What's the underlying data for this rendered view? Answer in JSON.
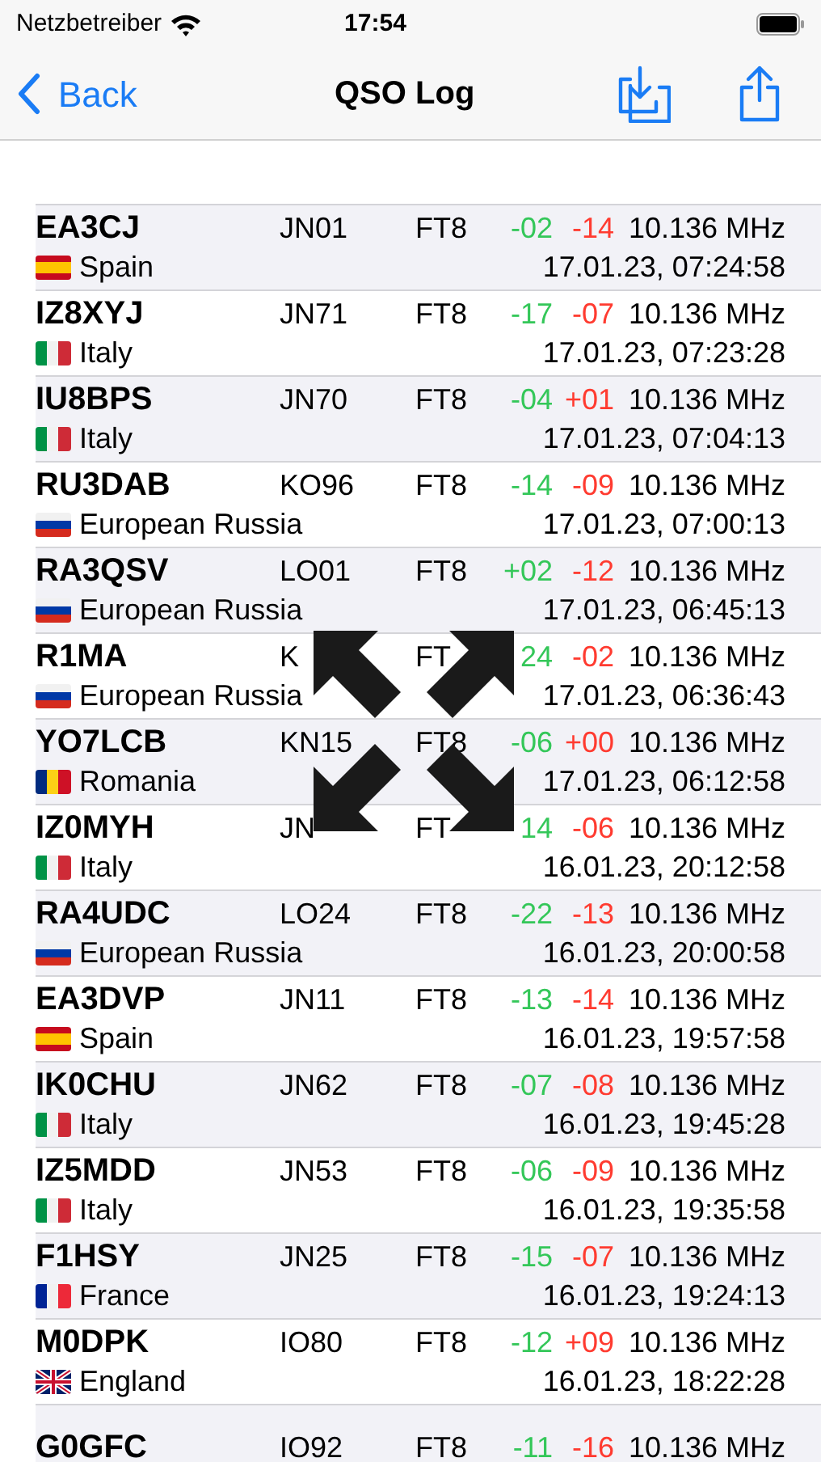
{
  "status_bar": {
    "carrier": "Netzbetreiber",
    "time": "17:54"
  },
  "nav": {
    "back": "Back",
    "title": "QSO Log"
  },
  "rows": [
    {
      "call": "EA3CJ",
      "grid": "JN01",
      "mode": "FT8",
      "sent": "-02",
      "rcvd": "-14",
      "freq": "10.136 MHz",
      "country": {
        "kind": "es",
        "name": "Spain"
      },
      "date": "17.01.23, 07:24:58"
    },
    {
      "call": "IZ8XYJ",
      "grid": "JN71",
      "mode": "FT8",
      "sent": "-17",
      "rcvd": "-07",
      "freq": "10.136 MHz",
      "country": {
        "kind": "it",
        "name": "Italy"
      },
      "date": "17.01.23, 07:23:28"
    },
    {
      "call": "IU8BPS",
      "grid": "JN70",
      "mode": "FT8",
      "sent": "-04",
      "rcvd": "+01",
      "freq": "10.136 MHz",
      "country": {
        "kind": "it",
        "name": "Italy"
      },
      "date": "17.01.23, 07:04:13"
    },
    {
      "call": "RU3DAB",
      "grid": "KO96",
      "mode": "FT8",
      "sent": "-14",
      "rcvd": "-09",
      "freq": "10.136 MHz",
      "country": {
        "kind": "ru",
        "name": "European Russia"
      },
      "date": "17.01.23, 07:00:13"
    },
    {
      "call": "RA3QSV",
      "grid": "LO01",
      "mode": "FT8",
      "sent": "+02",
      "rcvd": "-12",
      "freq": "10.136 MHz",
      "country": {
        "kind": "ru",
        "name": "European Russia"
      },
      "date": "17.01.23, 06:45:13"
    },
    {
      "call": "R1MA",
      "grid": "K",
      "mode": "FT",
      "sent": "24",
      "rcvd": "-02",
      "freq": "10.136 MHz",
      "country": {
        "kind": "ru",
        "name": "European Russia"
      },
      "date": "17.01.23, 06:36:43"
    },
    {
      "call": "YO7LCB",
      "grid": "KN15",
      "mode": "FT8",
      "sent": "-06",
      "rcvd": "+00",
      "freq": "10.136 MHz",
      "country": {
        "kind": "ro",
        "name": "Romania"
      },
      "date": "17.01.23, 06:12:58"
    },
    {
      "call": "IZ0MYH",
      "grid": "JN",
      "mode": "FT",
      "sent": "14",
      "rcvd": "-06",
      "freq": "10.136 MHz",
      "country": {
        "kind": "it",
        "name": "Italy"
      },
      "date": "16.01.23, 20:12:58"
    },
    {
      "call": "RA4UDC",
      "grid": "LO24",
      "mode": "FT8",
      "sent": "-22",
      "rcvd": "-13",
      "freq": "10.136 MHz",
      "country": {
        "kind": "ru",
        "name": "European Russia"
      },
      "date": "16.01.23, 20:00:58"
    },
    {
      "call": "EA3DVP",
      "grid": "JN11",
      "mode": "FT8",
      "sent": "-13",
      "rcvd": "-14",
      "freq": "10.136 MHz",
      "country": {
        "kind": "es",
        "name": "Spain"
      },
      "date": "16.01.23, 19:57:58"
    },
    {
      "call": "IK0CHU",
      "grid": "JN62",
      "mode": "FT8",
      "sent": "-07",
      "rcvd": "-08",
      "freq": "10.136 MHz",
      "country": {
        "kind": "it",
        "name": "Italy"
      },
      "date": "16.01.23, 19:45:28"
    },
    {
      "call": "IZ5MDD",
      "grid": "JN53",
      "mode": "FT8",
      "sent": "-06",
      "rcvd": "-09",
      "freq": "10.136 MHz",
      "country": {
        "kind": "it",
        "name": "Italy"
      },
      "date": "16.01.23, 19:35:58"
    },
    {
      "call": "F1HSY",
      "grid": "JN25",
      "mode": "FT8",
      "sent": "-15",
      "rcvd": "-07",
      "freq": "10.136 MHz",
      "country": {
        "kind": "fr",
        "name": "France"
      },
      "date": "16.01.23, 19:24:13"
    },
    {
      "call": "M0DPK",
      "grid": "IO80",
      "mode": "FT8",
      "sent": "-12",
      "rcvd": "+09",
      "freq": "10.136 MHz",
      "country": {
        "kind": "gb",
        "name": "England"
      },
      "date": "16.01.23, 18:22:28"
    },
    {
      "call": "G0GFC",
      "grid": "IO92",
      "mode": "FT8",
      "sent": "-11",
      "rcvd": "-16",
      "freq": "10.136 MHz"
    }
  ]
}
